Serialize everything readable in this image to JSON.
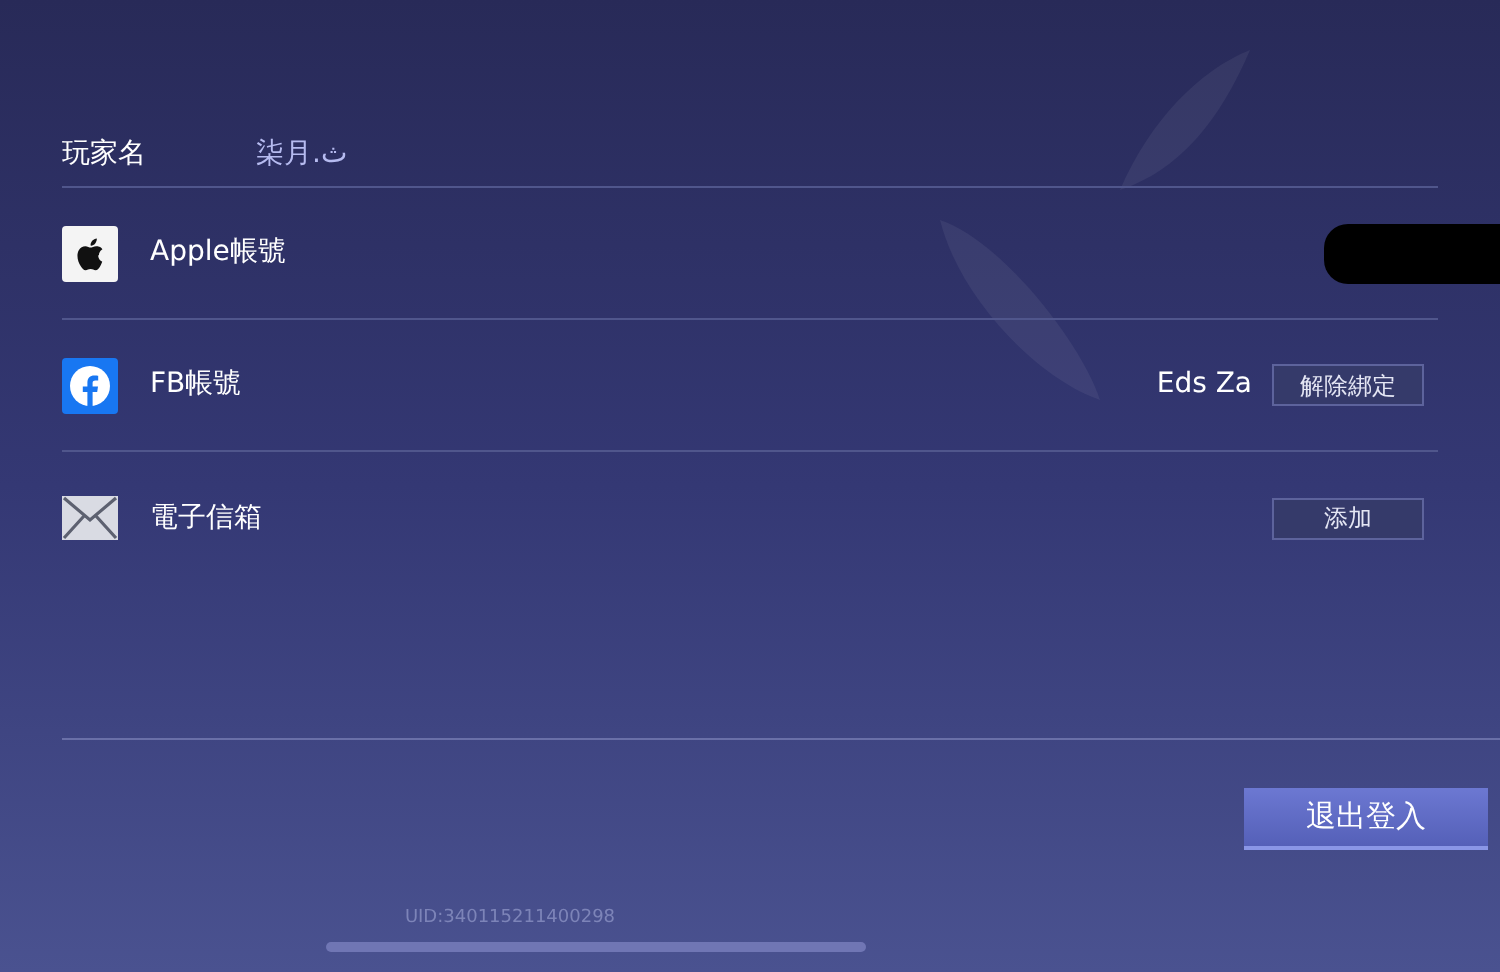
{
  "player": {
    "label": "玩家名",
    "name": "柒月.ث"
  },
  "accounts": [
    {
      "kind": "apple",
      "label": "Apple帳號",
      "redacted": true
    },
    {
      "kind": "facebook",
      "label": "FB帳號",
      "linked_name": "Eds Za",
      "button": "解除綁定"
    },
    {
      "kind": "email",
      "label": "電子信箱",
      "button": "添加"
    }
  ],
  "logout_button": "退出登入",
  "uid": "UID:340115211400298"
}
